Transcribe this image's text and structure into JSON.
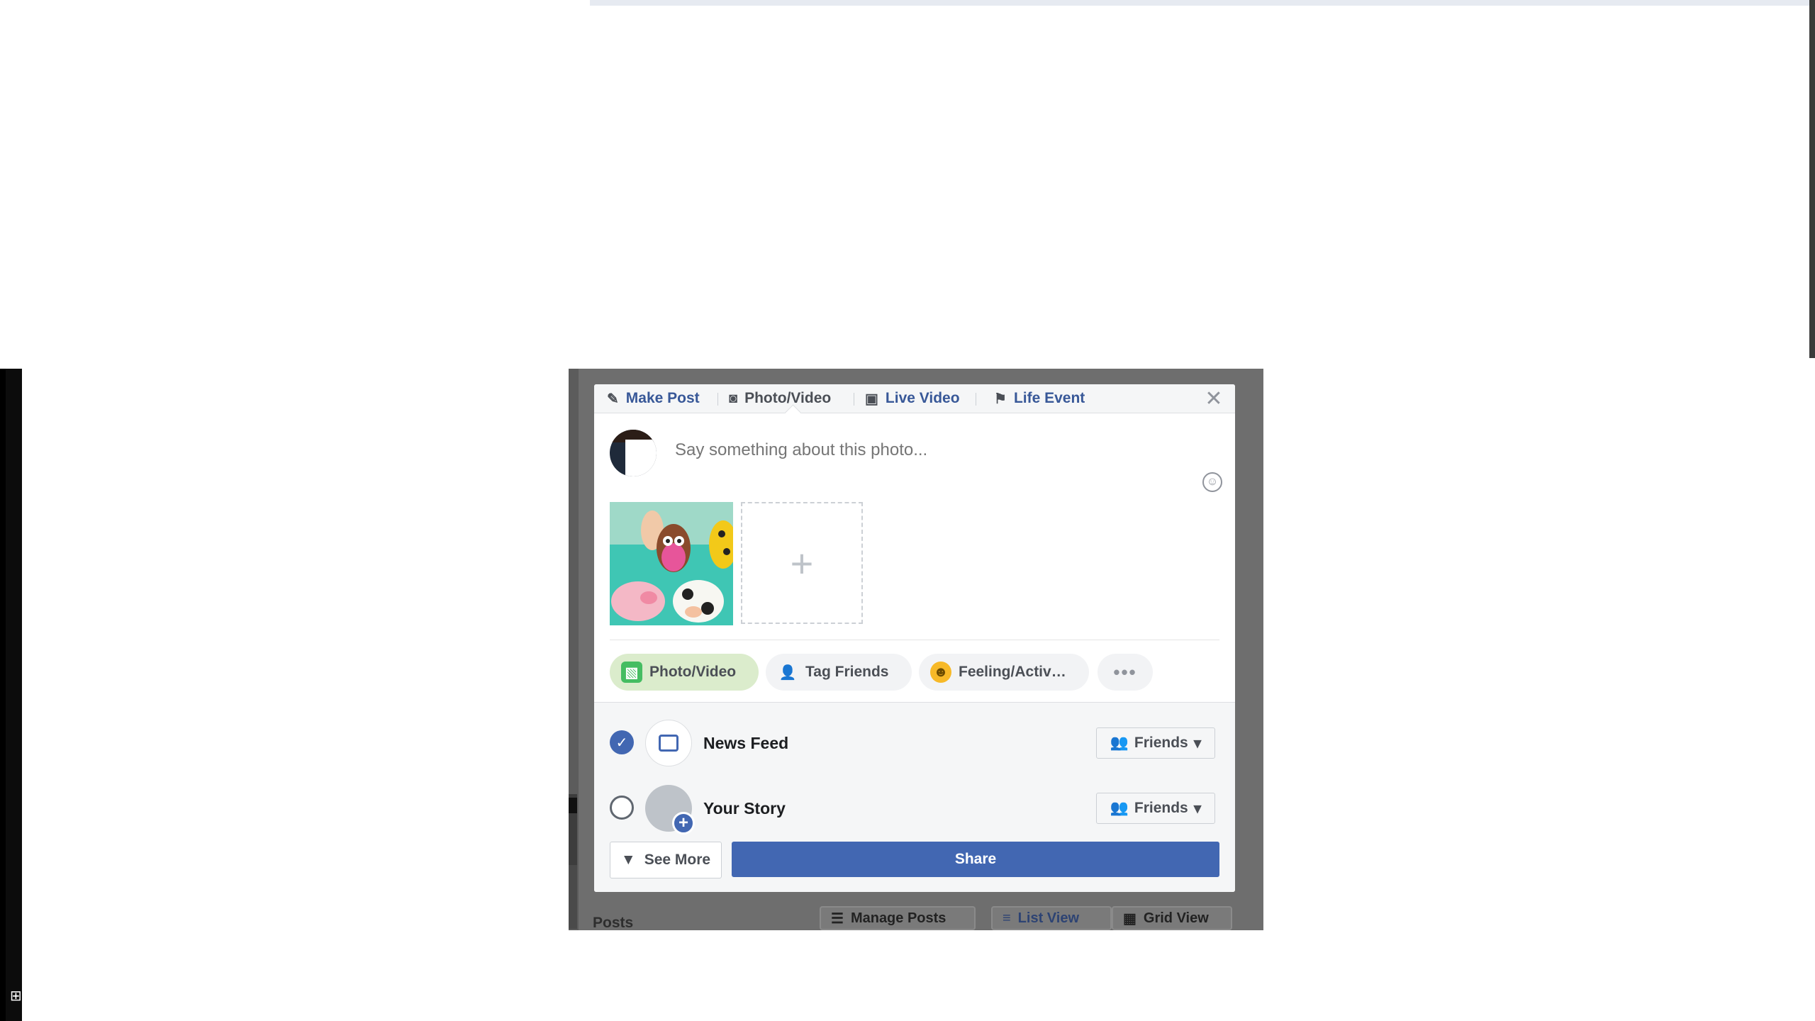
{
  "composer": {
    "tabs": [
      {
        "label": "Make Post",
        "icon": "pencil-icon"
      },
      {
        "label": "Photo/Video",
        "icon": "camera-icon"
      },
      {
        "label": "Live Video",
        "icon": "video-camera-icon"
      },
      {
        "label": "Life Event",
        "icon": "flag-icon"
      }
    ],
    "input_placeholder": "Say something about this photo...",
    "actions": [
      {
        "label": "Photo/Video",
        "icon": "photo-icon"
      },
      {
        "label": "Tag Friends",
        "icon": "tag-friends-icon"
      },
      {
        "label": "Feeling/Activ…",
        "icon": "smiley-icon"
      },
      {
        "label": "•••",
        "icon": "more-icon"
      }
    ],
    "audience": [
      {
        "label": "News Feed",
        "selected": true,
        "privacy": "Friends"
      },
      {
        "label": "Your Story",
        "selected": false,
        "privacy": "Friends"
      }
    ],
    "see_more": "See More",
    "share": "Share"
  },
  "background": {
    "posts_heading": "Posts",
    "manage_posts": "Manage Posts",
    "list_view": "List View",
    "grid_view": "Grid View"
  },
  "colors": {
    "brand": "#4267b2",
    "link": "#385898",
    "chip_selected": "#dbeccc"
  }
}
